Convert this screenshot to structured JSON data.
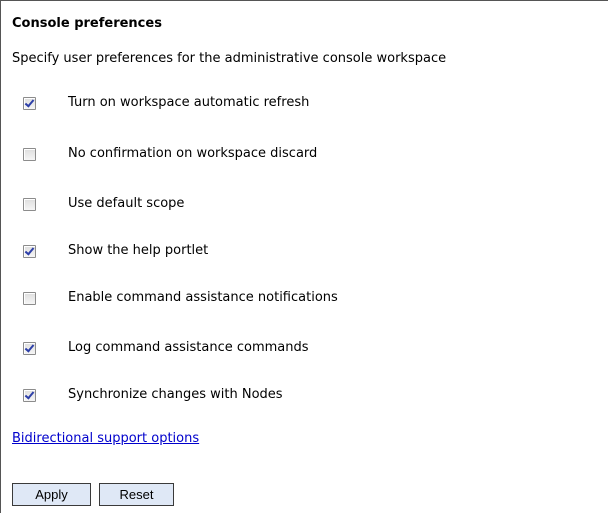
{
  "panel": {
    "title": "Console preferences",
    "description": "Specify user preferences for the administrative console workspace"
  },
  "preferences": [
    {
      "label": "Turn on workspace automatic refresh",
      "checked": true
    },
    {
      "label": "No confirmation on workspace discard",
      "checked": false
    },
    {
      "label": "Use default scope",
      "checked": false
    },
    {
      "label": "Show the help portlet",
      "checked": true
    },
    {
      "label": "Enable command assistance notifications",
      "checked": false
    },
    {
      "label": "Log command assistance commands",
      "checked": true
    },
    {
      "label": "Synchronize changes with Nodes",
      "checked": true
    }
  ],
  "links": {
    "bidirectional": "Bidirectional support options"
  },
  "buttons": {
    "apply": "Apply",
    "reset": "Reset"
  },
  "colors": {
    "link": "#0000cc",
    "checkmark": "#2d3fa8",
    "button_bg": "#dfe8f6"
  }
}
